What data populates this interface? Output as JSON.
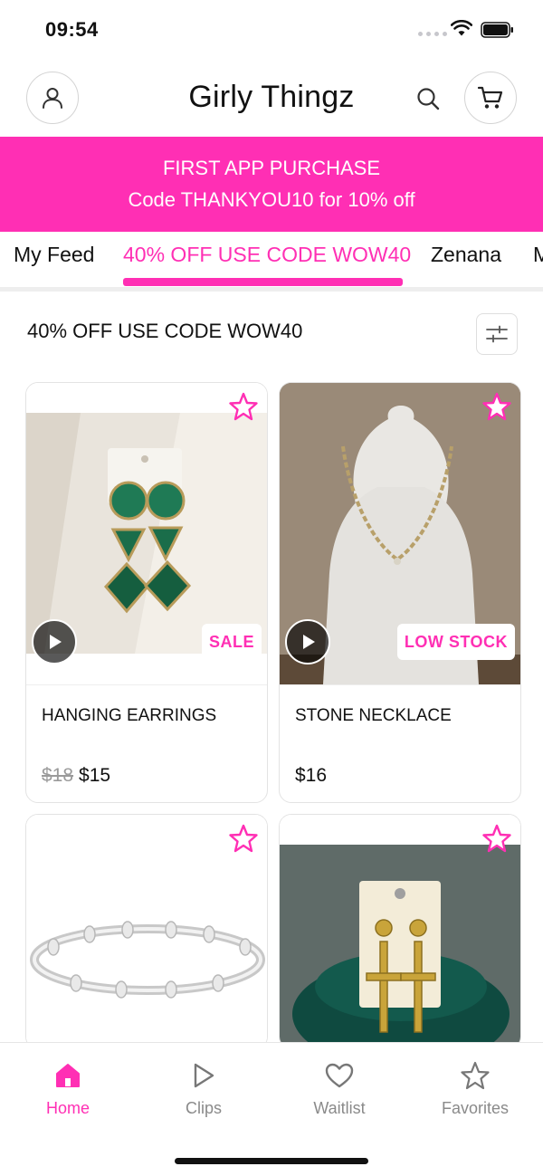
{
  "status_bar": {
    "time": "09:54"
  },
  "header": {
    "title": "Girly Thingz"
  },
  "promo": {
    "line1": "FIRST APP PURCHASE",
    "line2": "Code THANKYOU10 for 10% off"
  },
  "tabs": [
    {
      "label": "My Feed"
    },
    {
      "label": "40% OFF USE CODE WOW40",
      "active": true
    },
    {
      "label": "Zenana"
    },
    {
      "label": "M"
    }
  ],
  "section": {
    "title": "40% OFF USE CODE WOW40"
  },
  "products": [
    {
      "name": "HANGING EARRINGS",
      "old_price": "$18",
      "price": "$15",
      "badge": "SALE",
      "has_video": true
    },
    {
      "name": "STONE NECKLACE",
      "old_price": "",
      "price": "$16",
      "badge": "LOW STOCK",
      "has_video": true
    },
    {
      "name": "",
      "price": "",
      "badge": ""
    },
    {
      "name": "",
      "price": "",
      "badge": ""
    }
  ],
  "tabbar": [
    {
      "label": "Home",
      "icon": "home-icon",
      "active": true
    },
    {
      "label": "Clips",
      "icon": "play-outline-icon"
    },
    {
      "label": "Waitlist",
      "icon": "heart-icon"
    },
    {
      "label": "Favorites",
      "icon": "star-icon"
    }
  ],
  "colors": {
    "accent": "#ff2fb4",
    "muted": "#8a8a8a",
    "border": "#e3e3e3"
  }
}
